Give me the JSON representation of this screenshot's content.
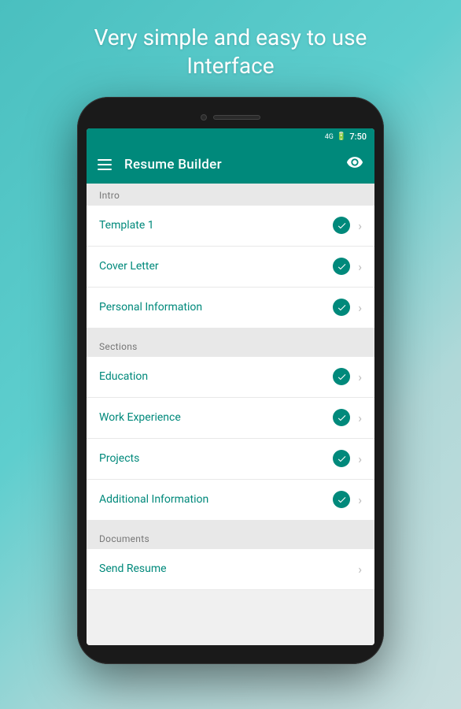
{
  "headline": {
    "line1": "Very simple and easy to use",
    "line2": "Interface"
  },
  "statusBar": {
    "signal": "4G",
    "battery": "▮",
    "time": "7:50"
  },
  "appBar": {
    "title": "Resume Builder"
  },
  "sections": [
    {
      "id": "intro",
      "header": "Intro",
      "items": [
        {
          "id": "template1",
          "label": "Template 1",
          "checked": true,
          "hasChevron": true
        },
        {
          "id": "cover-letter",
          "label": "Cover Letter",
          "checked": true,
          "hasChevron": true
        },
        {
          "id": "personal-info",
          "label": "Personal Information",
          "checked": true,
          "hasChevron": true
        }
      ]
    },
    {
      "id": "sections",
      "header": "Sections",
      "items": [
        {
          "id": "education",
          "label": "Education",
          "checked": true,
          "hasChevron": true
        },
        {
          "id": "work-experience",
          "label": "Work Experience",
          "checked": true,
          "hasChevron": true
        },
        {
          "id": "projects",
          "label": "Projects",
          "checked": true,
          "hasChevron": true
        },
        {
          "id": "additional-info",
          "label": "Additional Information",
          "checked": true,
          "hasChevron": true
        }
      ]
    },
    {
      "id": "documents",
      "header": "Documents",
      "items": [
        {
          "id": "send-resume",
          "label": "Send Resume",
          "checked": false,
          "hasChevron": true
        }
      ]
    }
  ],
  "colors": {
    "primary": "#00897b",
    "background": "#f0f0f0",
    "sectionHeader": "#e8e8e8"
  }
}
